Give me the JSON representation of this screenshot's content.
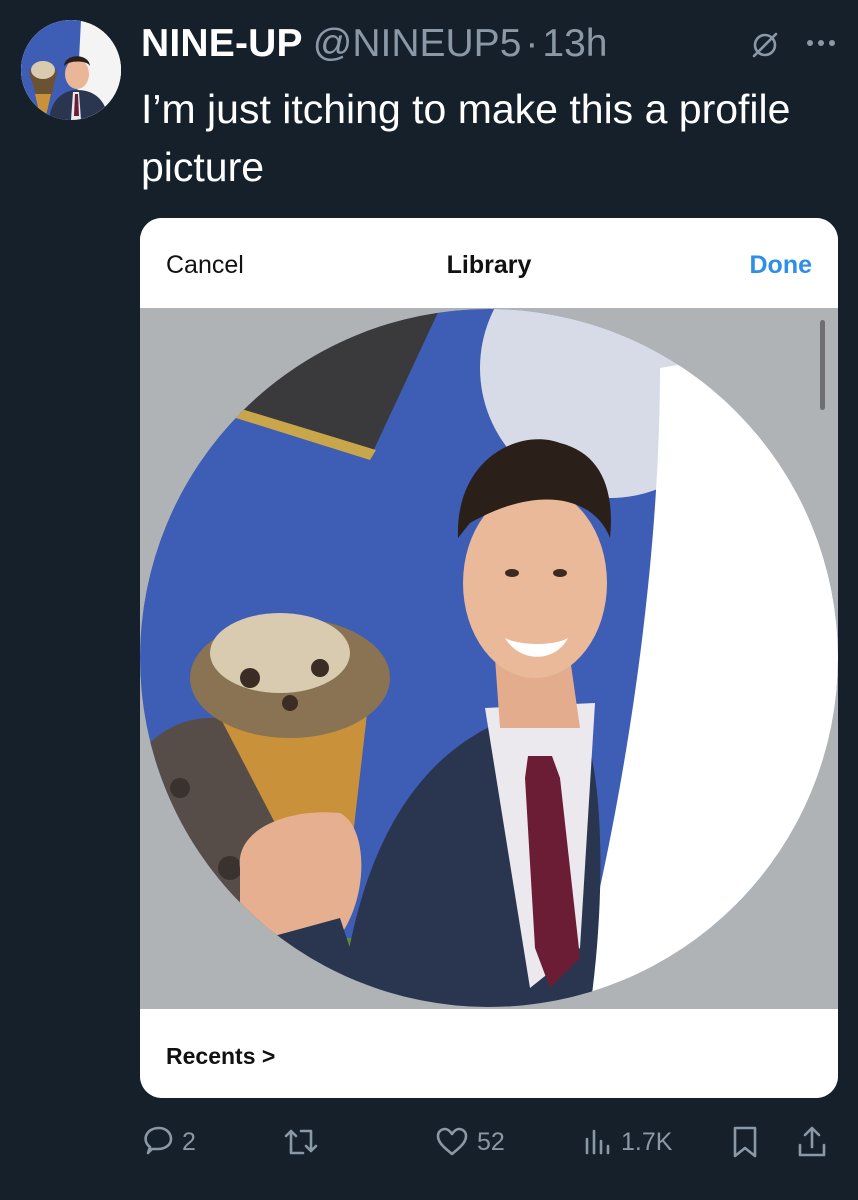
{
  "tweet": {
    "author_name": "NINE-UP",
    "handle": "@NINEUP5",
    "separator": "·",
    "time": "13h",
    "text": "I’m just itching to make this a profile picture"
  },
  "embedded_screen": {
    "cancel_label": "Cancel",
    "title": "Library",
    "done_label": "Done",
    "recents_label": "Recents",
    "recents_chevron": ">"
  },
  "actions": {
    "replies": "2",
    "retweets": "",
    "likes": "52",
    "views": "1.7K"
  },
  "icons": {
    "grok": "grok-icon",
    "more": "more-icon",
    "reply": "reply-icon",
    "retweet": "retweet-icon",
    "like": "heart-icon",
    "views": "views-icon",
    "bookmark": "bookmark-icon",
    "share": "share-icon"
  },
  "colors": {
    "background": "#15202b",
    "secondary_text": "#8b98a5",
    "done_blue": "#2f8ee8",
    "photo_blue": "#3e5db5",
    "suit_navy": "#2a3650"
  }
}
